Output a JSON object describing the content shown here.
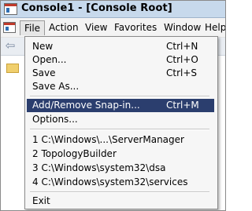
{
  "window": {
    "title": "Console1 - [Console Root]"
  },
  "menubar": {
    "items": [
      "File",
      "Action",
      "View",
      "Favorites",
      "Window",
      "Help"
    ]
  },
  "toolbar": {
    "back_icon": "back-arrow-icon"
  },
  "file_menu": {
    "items": [
      {
        "label": "New",
        "shortcut": "Ctrl+N"
      },
      {
        "label": "Open...",
        "shortcut": "Ctrl+O"
      },
      {
        "label": "Save",
        "shortcut": "Ctrl+S"
      },
      {
        "label": "Save As...",
        "shortcut": ""
      },
      {
        "label": "Add/Remove Snap-in...",
        "shortcut": "Ctrl+M"
      },
      {
        "label": "Options...",
        "shortcut": ""
      },
      {
        "label": "1 C:\\Windows\\...\\ServerManager",
        "shortcut": ""
      },
      {
        "label": "2 TopologyBuilder",
        "shortcut": ""
      },
      {
        "label": "3 C:\\Windows\\system32\\dsa",
        "shortcut": ""
      },
      {
        "label": "4 C:\\Windows\\system32\\services",
        "shortcut": ""
      },
      {
        "label": "Exit",
        "shortcut": ""
      }
    ],
    "highlighted_item": "Add/Remove Snap-in..."
  },
  "colors": {
    "titlebar": "#c7d9ec",
    "highlight": "#2b3e6e",
    "menu_background": "#f6f6f6"
  }
}
